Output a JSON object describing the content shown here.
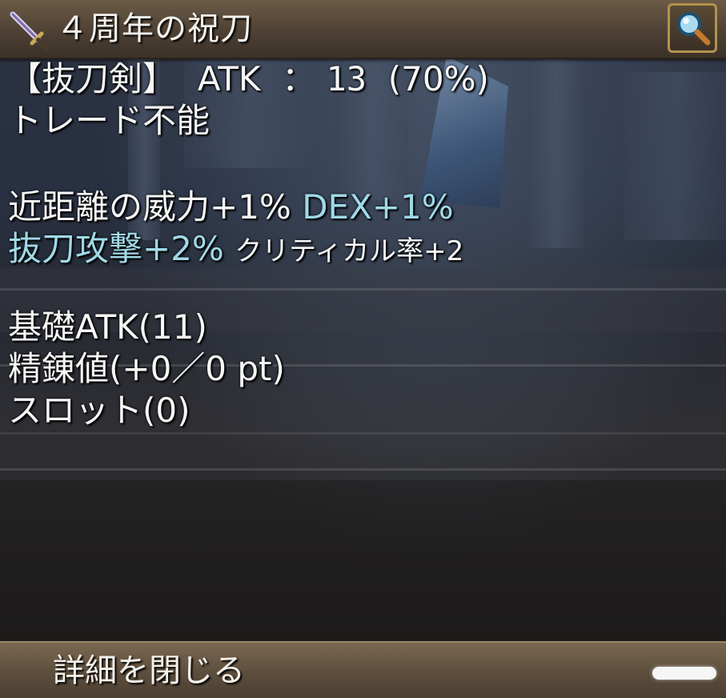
{
  "header": {
    "item_name": "４周年の祝刀",
    "weapon_icon": "katana-icon",
    "zoom_icon": "magnifier-icon"
  },
  "stats": {
    "line1": {
      "type": "【抜刀剣】",
      "atk_label": "ATK",
      "sep": "：",
      "atk_value": "13",
      "percent": "(70%)"
    },
    "trade": "トレード不能",
    "bonus1_left": "近距離の威力+1%",
    "bonus1_right": "DEX+1%",
    "bonus2_left": "抜刀攻撃+2%",
    "bonus2_right": "クリティカル率+2",
    "base_atk": "基礎ATK(11)",
    "refine": "精錬値(+0／0 pt)",
    "slot": "スロット(0)"
  },
  "footer": {
    "close_label": "詳細を閉じる",
    "minimize_icon": "minimize-bar-icon"
  },
  "colors": {
    "cyan_text": "#9fd9e8",
    "white_text": "#f7f7f7",
    "frame_brown": "#5d4e3d",
    "button_gold": "#b4924f"
  }
}
